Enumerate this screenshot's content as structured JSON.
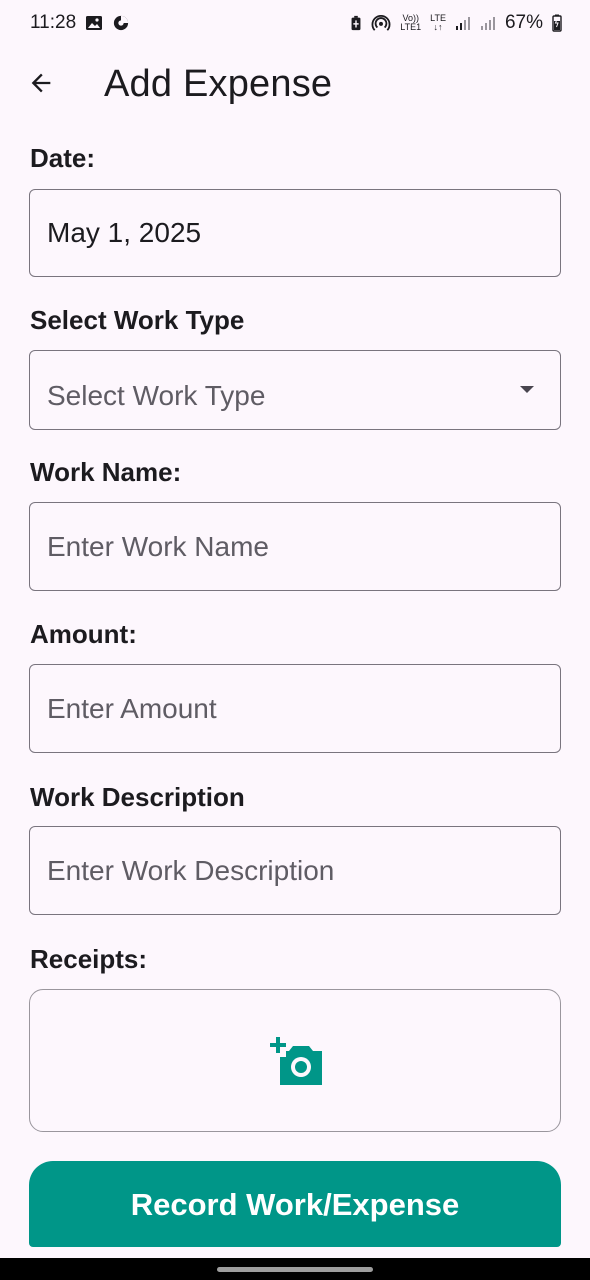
{
  "status_bar": {
    "time": "11:28",
    "left_icons": [
      "image-icon",
      "data-saver-icon"
    ],
    "right_icons": [
      "battery-saver-icon",
      "hotspot-icon",
      "volte-icon",
      "signal-icon",
      "signal-icon",
      "battery-icon"
    ],
    "volte_top": "Vo))",
    "volte_bottom": "LTE1",
    "lte_top": "LTE",
    "lte_bottom": "↓↑",
    "battery": "67%"
  },
  "app_bar": {
    "title": "Add Expense",
    "back_icon": "arrow-back-icon"
  },
  "form": {
    "date": {
      "label": "Date:",
      "value": "May 1, 2025"
    },
    "work_type": {
      "label": "Select Work Type",
      "placeholder": "Select Work Type"
    },
    "work_name": {
      "label": "Work Name:",
      "placeholder": "Enter Work Name"
    },
    "amount": {
      "label": "Amount:",
      "placeholder": "Enter Amount"
    },
    "description": {
      "label": "Work Description",
      "placeholder": "Enter Work Description"
    },
    "receipts": {
      "label": "Receipts:",
      "icon": "add-a-photo-icon"
    }
  },
  "submit_label": "Record Work/Expense",
  "colors": {
    "accent": "#009688",
    "background": "#fdf7fd",
    "border": "#79747e"
  }
}
